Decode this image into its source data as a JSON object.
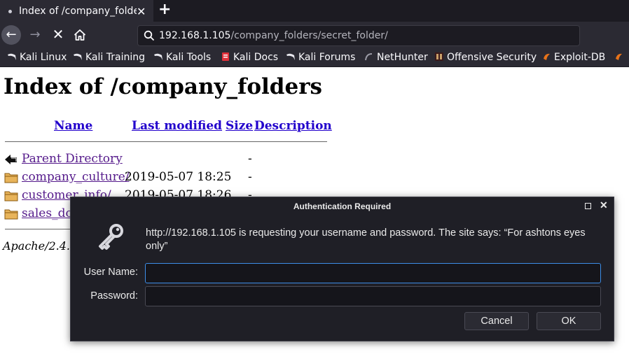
{
  "browser": {
    "tab": {
      "title": "Index of /company_folders/secret_folder",
      "close": "✕"
    },
    "new_tab": "+",
    "url": {
      "host": "192.168.1.105",
      "path": "/company_folders/secret_folder/"
    },
    "bookmarks": [
      {
        "label": "Kali Linux",
        "icon": "kali-dragon-icon"
      },
      {
        "label": "Kali Training",
        "icon": "kali-dragon-icon"
      },
      {
        "label": "Kali Tools",
        "icon": "kali-dragon-icon"
      },
      {
        "label": "Kali Docs",
        "icon": "kali-docs-icon"
      },
      {
        "label": "Kali Forums",
        "icon": "kali-dragon-icon"
      },
      {
        "label": "NetHunter",
        "icon": "nethunter-icon"
      },
      {
        "label": "Offensive Security",
        "icon": "offsec-icon"
      },
      {
        "label": "Exploit-DB",
        "icon": "exploit-db-icon"
      }
    ]
  },
  "page": {
    "title": "Index of /company_folders",
    "columns": {
      "name": "Name",
      "modified": "Last modified",
      "size": "Size",
      "description": "Description"
    },
    "rows": [
      {
        "name": "Parent Directory",
        "modified": "",
        "size": "-"
      },
      {
        "name": "company_culture/",
        "modified": "2019-05-07 18:25",
        "size": "-"
      },
      {
        "name": "customer_info/",
        "modified": "2019-05-07 18:26",
        "size": "-"
      },
      {
        "name": "sales_do",
        "modified": "",
        "size": ""
      }
    ],
    "footer": "Apache/2.4.."
  },
  "dialog": {
    "title": "Authentication Required",
    "message": "http://192.168.1.105 is requesting your username and password. The site says: “For ashtons eyes only”",
    "username_label": "User Name:",
    "username_value": "",
    "password_label": "Password:",
    "password_value": "",
    "cancel_label": "Cancel",
    "ok_label": "OK"
  }
}
